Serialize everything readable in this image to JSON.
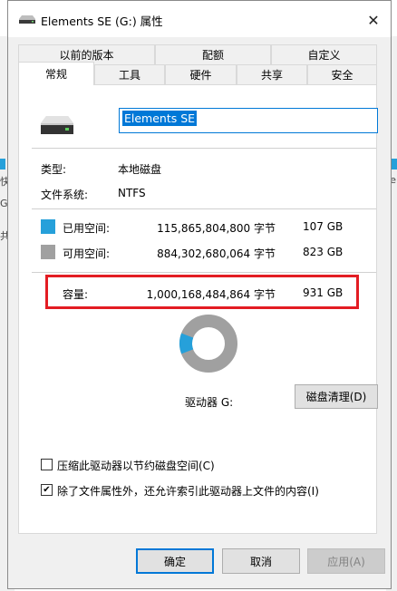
{
  "background": {
    "left_texts": [
      "快",
      "G:",
      "共"
    ],
    "right_texts": [
      "e"
    ]
  },
  "window": {
    "title": "Elements SE (G:) 属性",
    "close_glyph": "✕"
  },
  "tabs": {
    "row1": [
      {
        "label": "以前的版本"
      },
      {
        "label": "配额"
      },
      {
        "label": "自定义"
      }
    ],
    "row2": [
      {
        "label": "常规",
        "active": true
      },
      {
        "label": "工具"
      },
      {
        "label": "硬件"
      },
      {
        "label": "共享"
      },
      {
        "label": "安全"
      }
    ]
  },
  "general": {
    "drive_name": "Elements SE",
    "type_label": "类型:",
    "type_value": "本地磁盘",
    "fs_label": "文件系统:",
    "fs_value": "NTFS",
    "used": {
      "label": "已用空间:",
      "bytes": "115,865,804,800 字节",
      "size": "107 GB"
    },
    "free": {
      "label": "可用空间:",
      "bytes": "884,302,680,064 字节",
      "size": "823 GB"
    },
    "capacity": {
      "label": "容量:",
      "bytes": "1,000,168,484,864 字节",
      "size": "931 GB"
    },
    "drive_label": "驱动器 G:",
    "cleanup_button": "磁盘清理(D)",
    "compress_label": "压缩此驱动器以节约磁盘空间(C)",
    "compress_checked": false,
    "index_label": "除了文件属性外，还允许索引此驱动器上文件的内容(I)",
    "index_checked": true,
    "used_fraction": 0.116
  },
  "buttons": {
    "ok": "确定",
    "cancel": "取消",
    "apply": "应用(A)"
  },
  "colors": {
    "used": "#26a0da",
    "free": "#a0a0a0",
    "highlight_box": "#e31c23",
    "accent": "#0078d7"
  }
}
